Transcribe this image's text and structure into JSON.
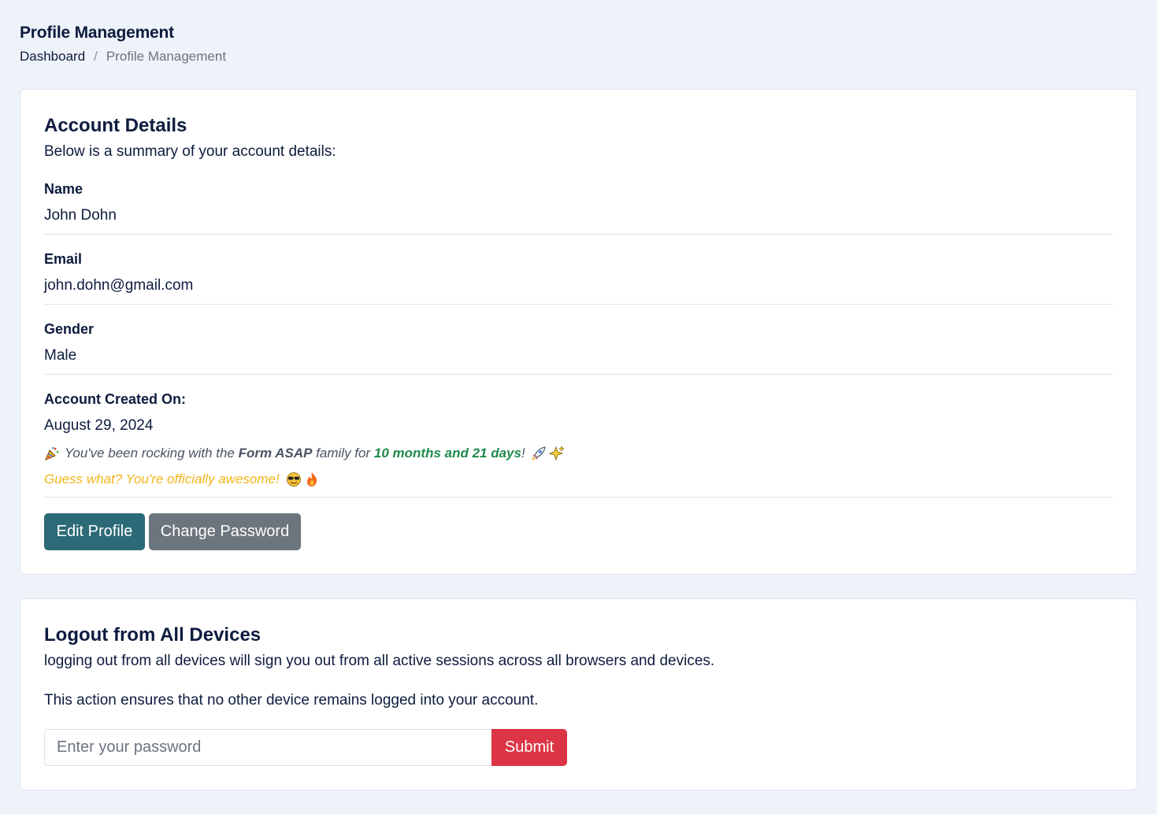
{
  "header": {
    "title": "Profile Management",
    "breadcrumb": {
      "home": "Dashboard",
      "separator": "/",
      "current": "Profile Management"
    }
  },
  "account_card": {
    "title": "Account Details",
    "subtitle": "Below is a summary of your account details:",
    "fields": [
      {
        "label": "Name",
        "value": "John Dohn"
      },
      {
        "label": "Email",
        "value": "john.dohn@gmail.com"
      },
      {
        "label": "Gender",
        "value": "Male"
      },
      {
        "label": "Account Created On:",
        "value": "August 29, 2024"
      }
    ],
    "tenure": {
      "prefix": "You've been rocking with the ",
      "brand": "Form ASAP",
      "middle": " family for ",
      "duration": "10 months and 21 days",
      "suffix": "!",
      "lead_icon": "party-popper-icon",
      "trail_icons": [
        "rocket-icon",
        "sparkles-icon"
      ]
    },
    "awesome": {
      "text": "Guess what? You're officially awesome!",
      "icons": [
        "sunglasses-face-icon",
        "fire-icon"
      ]
    },
    "buttons": {
      "edit": "Edit Profile",
      "change_password": "Change Password"
    }
  },
  "logout_card": {
    "title": "Logout from All Devices",
    "description": "logging out from all devices will sign you out from all active sessions across all browsers and devices.",
    "note": "This action ensures that no other device remains logged into your account.",
    "password": {
      "placeholder": "Enter your password",
      "value": ""
    },
    "submit": "Submit"
  },
  "colors": {
    "background": "#eef2f9",
    "primary_text": "#0d1b3e",
    "edit_button": "#2d6a78",
    "secondary_button": "#6c757d",
    "danger_button": "#dc3545",
    "success_text": "#1e8a4c",
    "highlight_text": "#f2b51a"
  }
}
